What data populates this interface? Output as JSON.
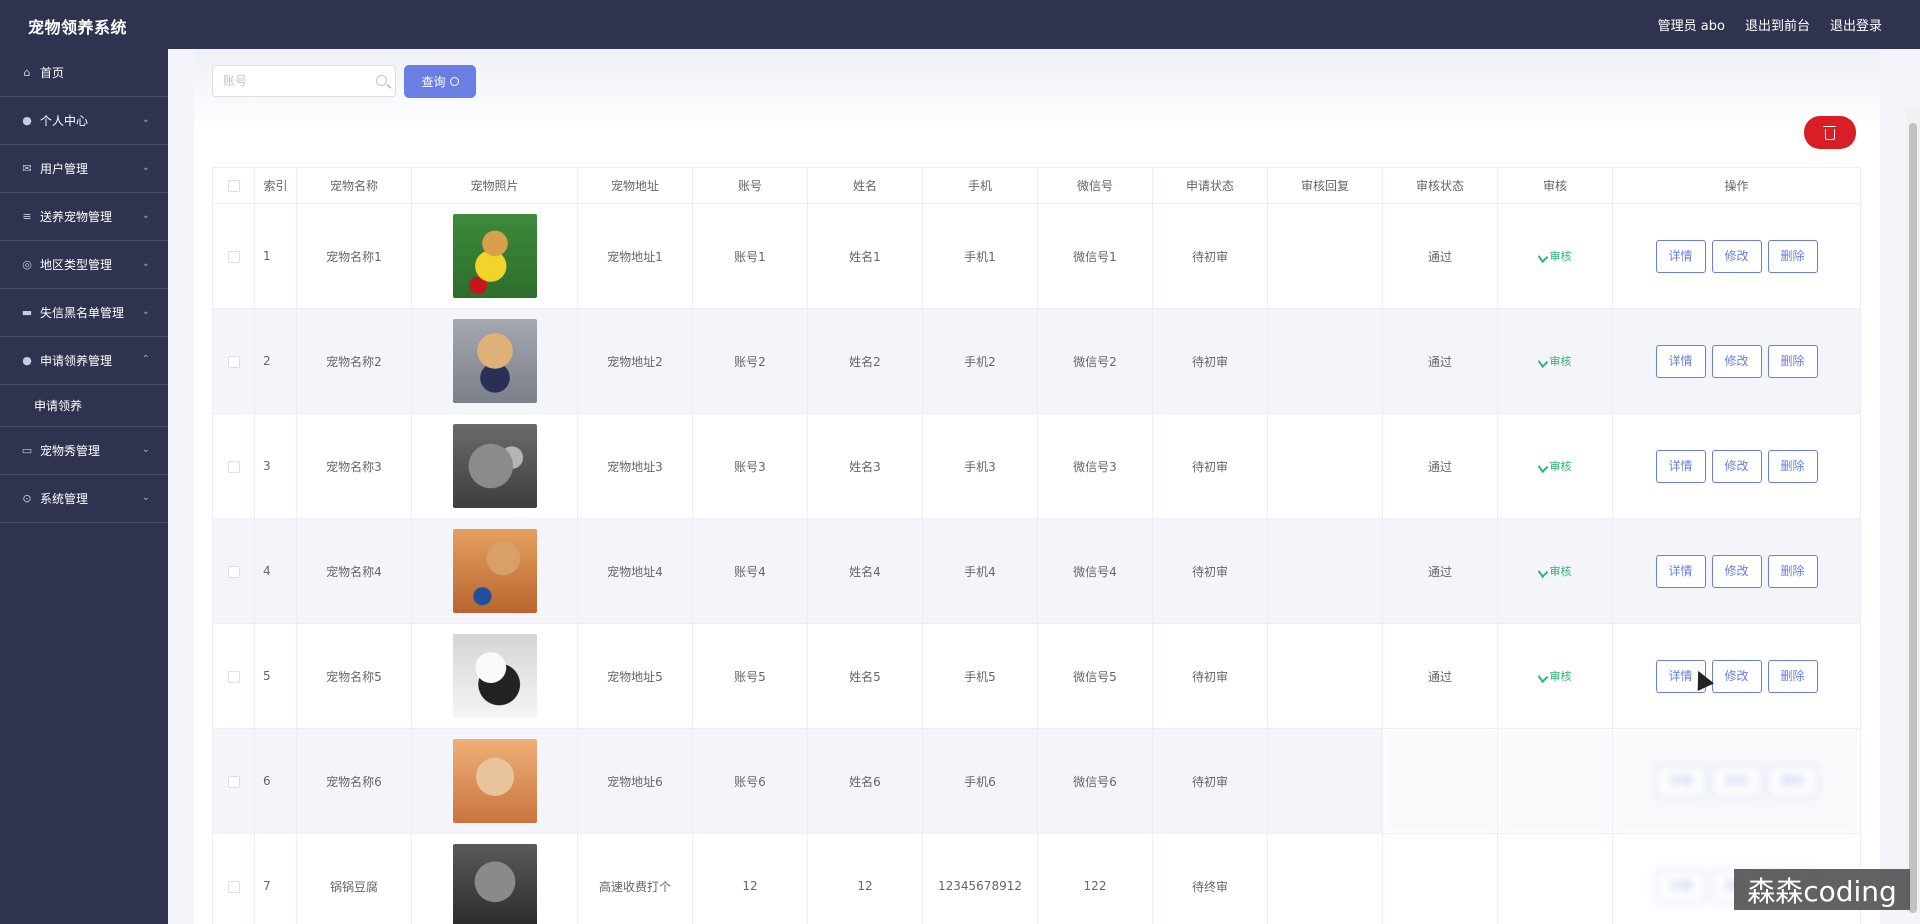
{
  "header": {
    "brand": "宠物领养系统",
    "admin_label": "管理员 abo",
    "to_front": "退出到前台",
    "logout": "退出登录"
  },
  "sidebar": {
    "items": [
      {
        "label": "首页",
        "icon": "home-icon"
      },
      {
        "label": "个人中心",
        "icon": "user-icon"
      },
      {
        "label": "用户管理",
        "icon": "mail-icon"
      },
      {
        "label": "送养宠物管理",
        "icon": "list-icon"
      },
      {
        "label": "地区类型管理",
        "icon": "target-icon"
      },
      {
        "label": "失信黑名单管理",
        "icon": "monitor-icon"
      },
      {
        "label": "申请领养管理",
        "icon": "user-icon"
      },
      {
        "label": "宠物秀管理",
        "icon": "card-icon"
      },
      {
        "label": "系统管理",
        "icon": "settings-icon"
      }
    ],
    "submenu": {
      "label": "申请领养"
    }
  },
  "search": {
    "placeholder": "账号",
    "query_label": "查询"
  },
  "table": {
    "headers": [
      "索引",
      "宠物名称",
      "宠物照片",
      "宠物地址",
      "账号",
      "姓名",
      "手机",
      "微信号",
      "申请状态",
      "审核回复",
      "审核状态",
      "审核",
      "操作"
    ],
    "rows": [
      {
        "index": "1",
        "name": "宠物名称1",
        "address": "宠物地址1",
        "account": "账号1",
        "real_name": "姓名1",
        "phone": "手机1",
        "wechat": "微信号1",
        "apply_status": "待初审",
        "reply": "",
        "audit_status": "通过",
        "audit": "审核"
      },
      {
        "index": "2",
        "name": "宠物名称2",
        "address": "宠物地址2",
        "account": "账号2",
        "real_name": "姓名2",
        "phone": "手机2",
        "wechat": "微信号2",
        "apply_status": "待初审",
        "reply": "",
        "audit_status": "通过",
        "audit": "审核"
      },
      {
        "index": "3",
        "name": "宠物名称3",
        "address": "宠物地址3",
        "account": "账号3",
        "real_name": "姓名3",
        "phone": "手机3",
        "wechat": "微信号3",
        "apply_status": "待初审",
        "reply": "",
        "audit_status": "通过",
        "audit": "审核"
      },
      {
        "index": "4",
        "name": "宠物名称4",
        "address": "宠物地址4",
        "account": "账号4",
        "real_name": "姓名4",
        "phone": "手机4",
        "wechat": "微信号4",
        "apply_status": "待初审",
        "reply": "",
        "audit_status": "通过",
        "audit": "审核"
      },
      {
        "index": "5",
        "name": "宠物名称5",
        "address": "宠物地址5",
        "account": "账号5",
        "real_name": "姓名5",
        "phone": "手机5",
        "wechat": "微信号5",
        "apply_status": "待初审",
        "reply": "",
        "audit_status": "通过",
        "audit": "审核"
      },
      {
        "index": "6",
        "name": "宠物名称6",
        "address": "宠物地址6",
        "account": "账号6",
        "real_name": "姓名6",
        "phone": "手机6",
        "wechat": "微信号6",
        "apply_status": "待初审",
        "reply": "",
        "audit_status": "",
        "audit": ""
      },
      {
        "index": "7",
        "name": "锅锅豆腐",
        "address": "高速收费打个",
        "account": "12",
        "real_name": "12",
        "phone": "12345678912",
        "wechat": "122",
        "apply_status": "待终审",
        "reply": "",
        "audit_status": "",
        "audit": ""
      }
    ],
    "actions": {
      "detail": "详情",
      "edit": "修改",
      "delete": "删除"
    }
  },
  "watermark": "森森coding",
  "colors": {
    "sidebar_bg": "#2f3350",
    "primary": "#6a7ee3",
    "danger": "#d91e26",
    "audit_green": "#2bb673"
  }
}
